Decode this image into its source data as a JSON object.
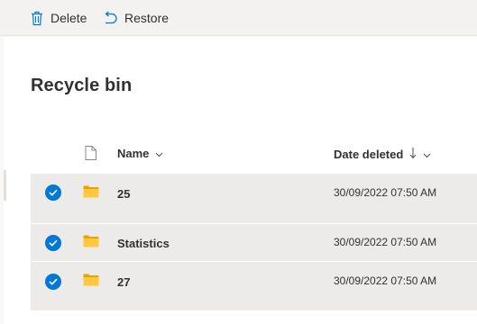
{
  "toolbar": {
    "delete_label": "Delete",
    "restore_label": "Restore"
  },
  "page": {
    "title": "Recycle bin"
  },
  "columns": {
    "name": "Name",
    "date_deleted": "Date deleted"
  },
  "rows": [
    {
      "name": "25",
      "date_deleted": "30/09/2022 07:50 AM",
      "selected": true
    },
    {
      "name": "Statistics",
      "date_deleted": "30/09/2022 07:50 AM",
      "selected": true
    },
    {
      "name": "27",
      "date_deleted": "30/09/2022 07:50 AM",
      "selected": true
    }
  ],
  "icons": {
    "delete": "trash-icon",
    "restore": "undo-icon",
    "file_type": "document-icon",
    "folder": "folder-icon",
    "check": "checkmark-circle-icon",
    "sort": "sort-down-arrow-icon",
    "chevron": "chevron-down-icon"
  },
  "colors": {
    "accent": "#0078d4",
    "folder": "#ffb900",
    "selected_row": "#edebe9",
    "command_bar": "#f3f2f1"
  }
}
